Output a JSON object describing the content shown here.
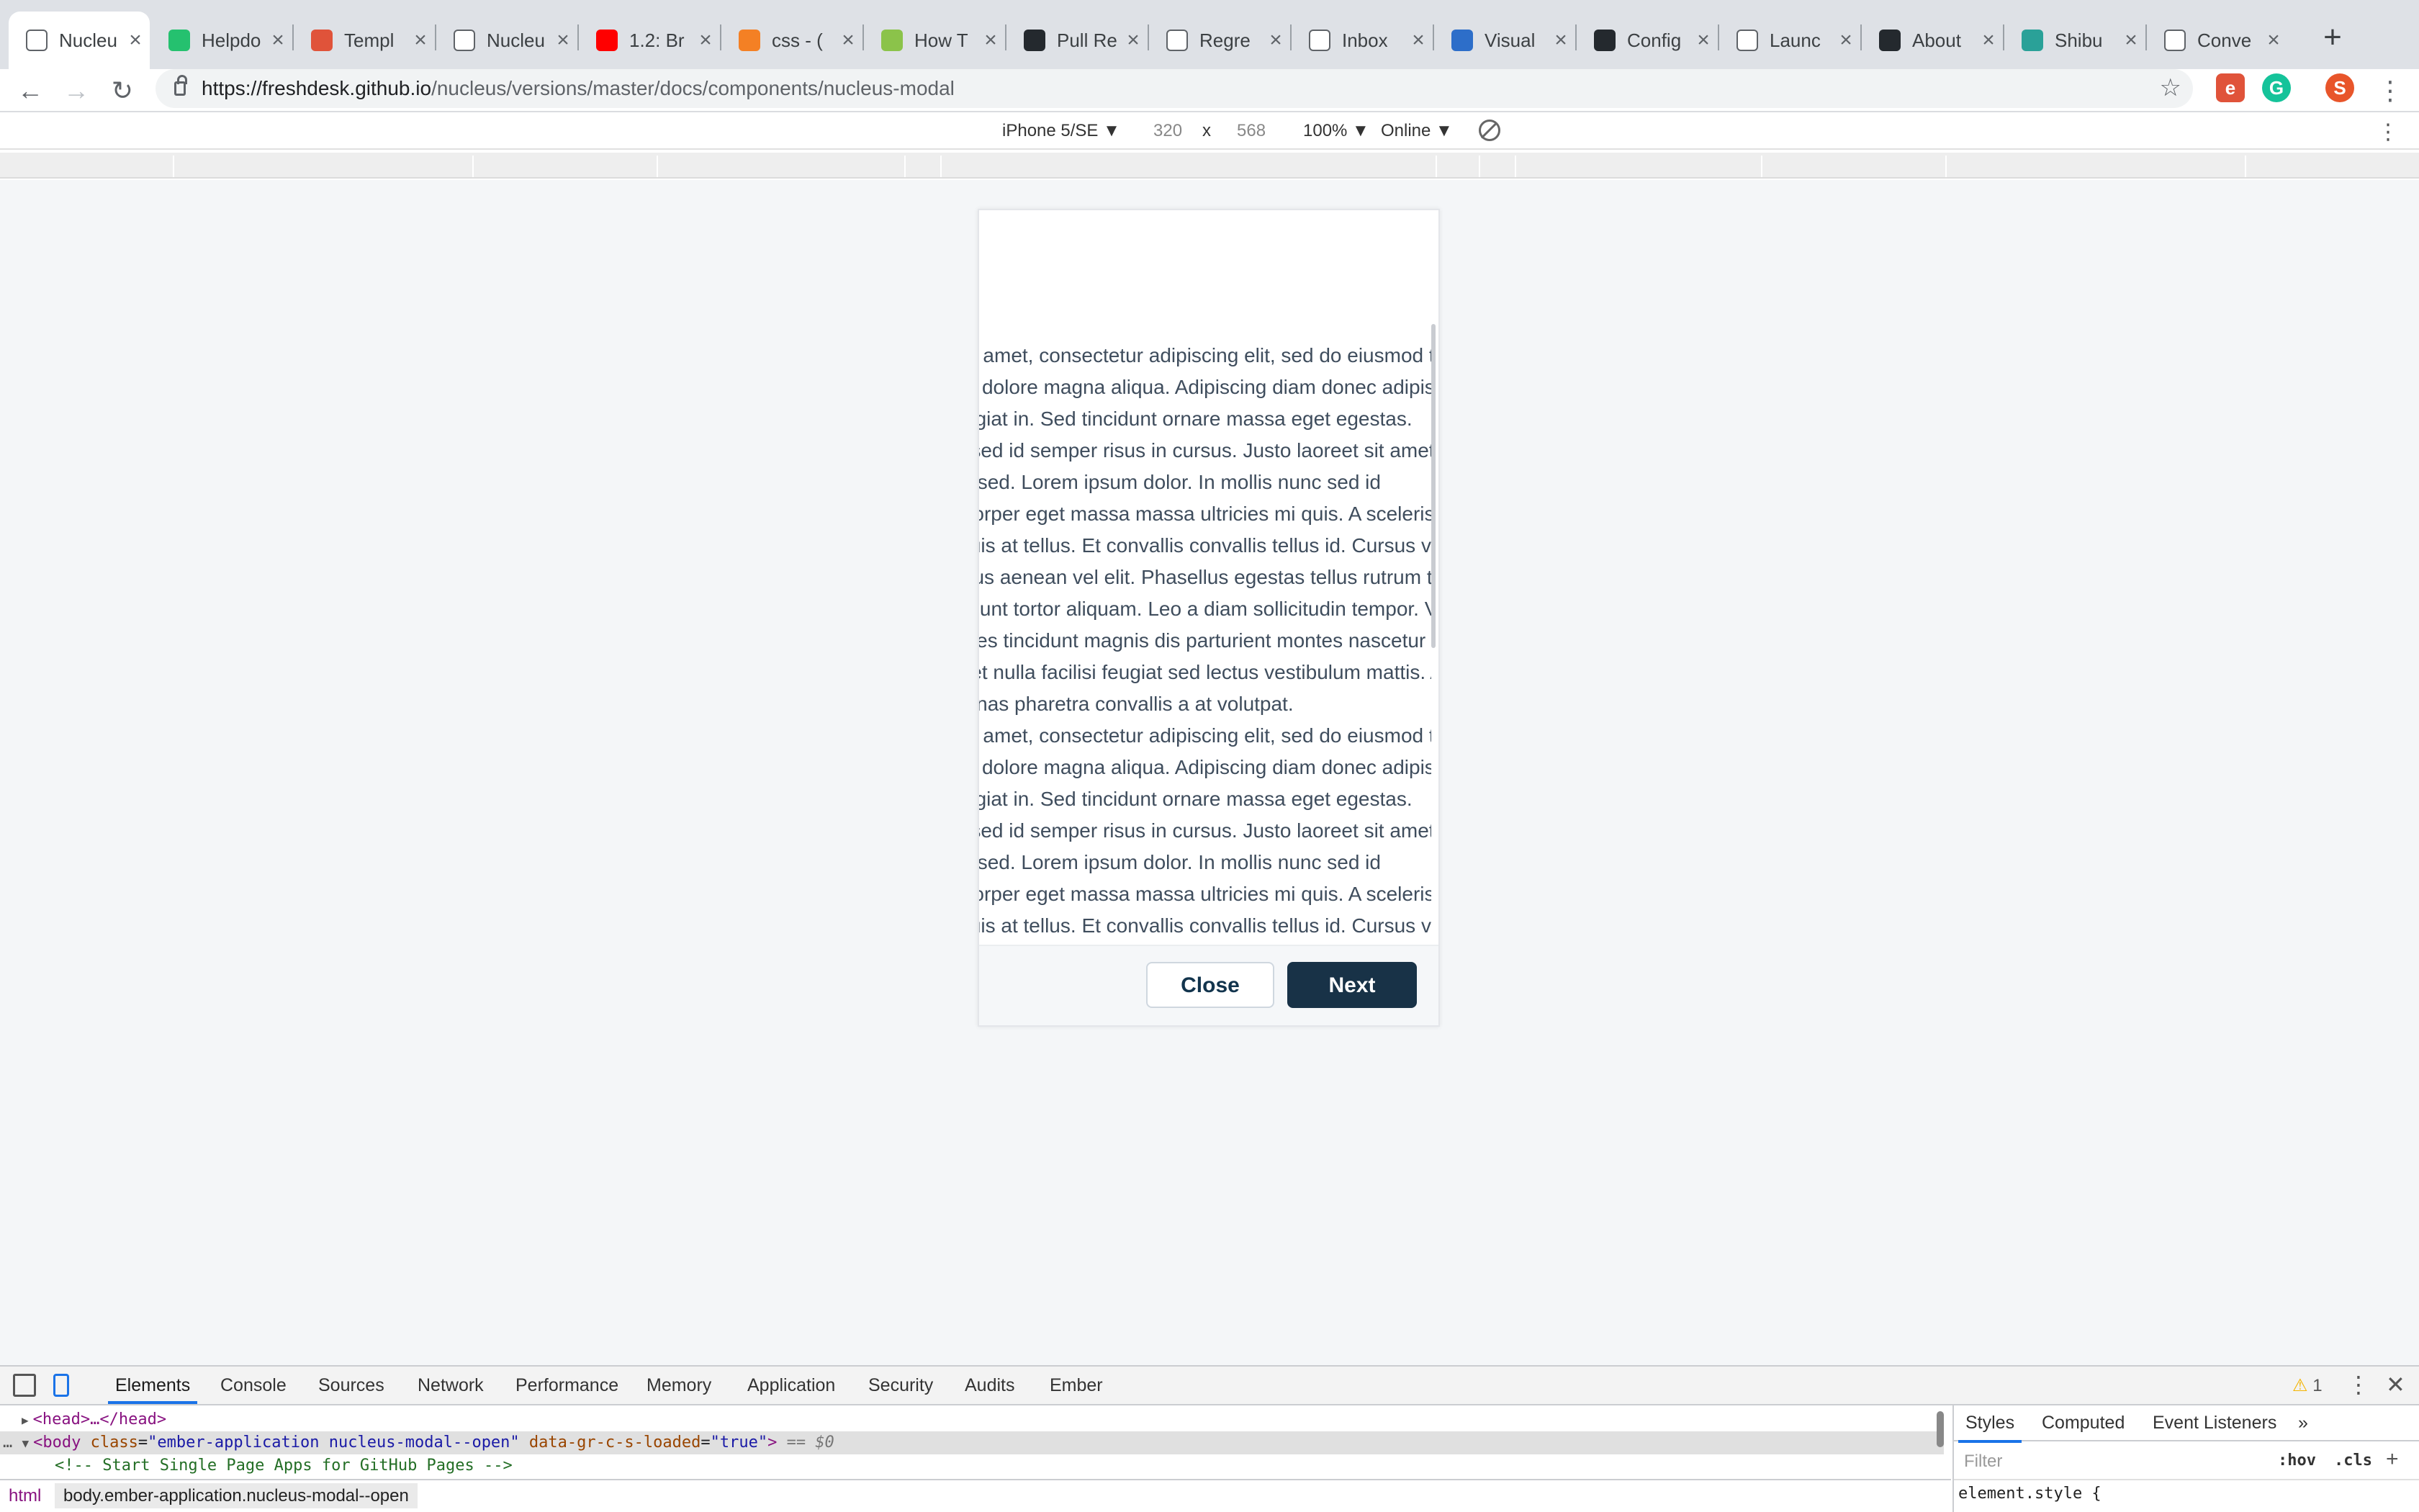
{
  "browser": {
    "tabs": [
      {
        "title": "Nucleu",
        "icon": "page-icon",
        "active": true
      },
      {
        "title": "Helpdo",
        "icon": "freshdesk-icon"
      },
      {
        "title": "Templ",
        "icon": "e-logo-icon"
      },
      {
        "title": "Nucleu",
        "icon": "page-icon"
      },
      {
        "title": "1.2: Br",
        "icon": "youtube-icon"
      },
      {
        "title": "css - (",
        "icon": "stackoverflow-icon"
      },
      {
        "title": "How T",
        "icon": "w3-icon"
      },
      {
        "title": "Pull Re",
        "icon": "github-icon"
      },
      {
        "title": "Regre",
        "icon": "wikipedia-icon"
      },
      {
        "title": "Inbox",
        "icon": "gmail-icon"
      },
      {
        "title": "Visual",
        "icon": "cloud-icon"
      },
      {
        "title": "Config",
        "icon": "github-icon"
      },
      {
        "title": "Launc",
        "icon": "launchdarkly-icon"
      },
      {
        "title": "About",
        "icon": "github-icon"
      },
      {
        "title": "Shibu",
        "icon": "avatar-icon"
      },
      {
        "title": "Conve",
        "icon": "page-icon"
      }
    ],
    "url_host": "https://freshdesk.github.io",
    "url_path": "/nucleus/versions/master/docs/components/nucleus-modal",
    "profile_initial": "S"
  },
  "device_toolbar": {
    "device": "iPhone 5/SE ▼",
    "width": "320",
    "times": "x",
    "height": "568",
    "zoom": "100% ▼",
    "network": "Online ▼"
  },
  "modal": {
    "paragraphs": [
      "Lorem ipsum dolor sit amet, consectetur adipiscing elit, sed do eiusmod tempor",
      "incididunt ut labore et dolore magna aliqua. Adipiscing diam donec adipiscing",
      "tristique risus nec feugiat in. Sed tincidunt ornare massa eget egestas.",
      "Purus in mollis nunc sed id semper risus in cursus. Justo laoreet sit amet cursus. Mi",
      "proin sed libero enim sed. Lorem ipsum dolor. In mollis nunc sed id",
      "semper risus. Ullamcorper eget massa massa ultricies mi quis. A scelerisque",
      "purus semper eget duis at tellus. Et convallis convallis tellus id. Cursus vitae",
      "congue mauris rhoncus aenean vel elit. Phasellus egestas tellus rutrum tellus",
      "pellentesque eu tincidunt tortor aliquam. Leo a diam sollicitudin tempor. Velit",
      "laoreet id donec ultrices tincidunt magnis dis parturient montes nascetur",
      "ridiculus mus. Sit amet nulla facilisi feugiat sed lectus vestibulum mattis. Ac",
      "turpis egestas maecenas pharetra convallis a at volutpat.",
      "Lorem ipsum dolor sit amet, consectetur adipiscing elit, sed do eiusmod tempor",
      "incididunt ut labore et dolore magna aliqua. Adipiscing diam donec adipiscing",
      "tristique risus nec feugiat in. Sed tincidunt ornare massa eget egestas.",
      "Purus in mollis nunc sed id semper risus in cursus. Justo laoreet sit amet cursus. Mi",
      "proin sed libero enim sed. Lorem ipsum dolor. In mollis nunc sed id",
      "semper risus. Ullamcorper eget massa massa ultricies mi quis. A scelerisque",
      "purus semper eget duis at tellus. Et convallis convallis tellus id. Cursus vitae"
    ],
    "close_label": "Close",
    "next_label": "Next"
  },
  "devtools": {
    "tabs": [
      "Elements",
      "Console",
      "Sources",
      "Network",
      "Performance",
      "Memory",
      "Application",
      "Security",
      "Audits",
      "Ember"
    ],
    "warning_count": "1",
    "code": {
      "head": "<head>…</head>",
      "body_open": "<body",
      "body_attr1_name": "class",
      "body_attr1_val": "\"ember-application nucleus-modal--open\"",
      "body_attr2_name": "data-gr-c-s-loaded",
      "body_attr2_val": "\"true\"",
      "body_close": ">",
      "dollar": "== $0",
      "comment": "<!-- Start Single Page Apps for GitHub Pages -->"
    },
    "breadcrumbs": [
      "html",
      "body.ember-application.nucleus-modal--open"
    ],
    "styles_tabs": [
      "Styles",
      "Computed",
      "Event Listeners",
      "»"
    ],
    "filter_placeholder": "Filter",
    "hov": ":hov",
    "cls": ".cls",
    "element_style": "element.style {"
  },
  "colors": {
    "primary_button": "#183247",
    "modal_text": "#3f4d5d",
    "devtools_accent": "#1a73e8"
  }
}
